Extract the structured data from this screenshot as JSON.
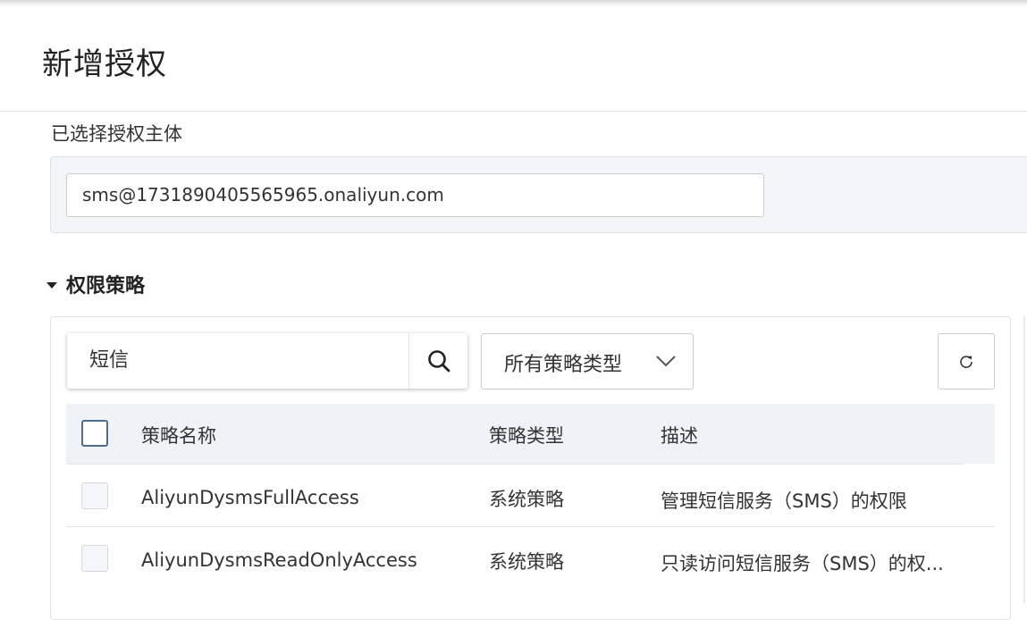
{
  "dialog": {
    "title": "新增授权",
    "selected_principal_label": "已选择授权主体",
    "principal_value": "sms@1731890405565965.onaliyun.com"
  },
  "policy_section": {
    "title": "权限策略",
    "search_value": "短信",
    "type_filter": "所有策略类型",
    "icons": {
      "search": "search-icon",
      "dropdown": "chevron-down-icon",
      "refresh": "refresh-icon",
      "collapse": "caret-down-icon"
    },
    "columns": [
      "策略名称",
      "策略类型",
      "描述"
    ],
    "rows": [
      {
        "name": "AliyunDysmsFullAccess",
        "type": "系统策略",
        "description": "管理短信服务（SMS）的权限"
      },
      {
        "name": "AliyunDysmsReadOnlyAccess",
        "type": "系统策略",
        "description": "只读访问短信服务（SMS）的权..."
      }
    ]
  },
  "colors": {
    "header_bg": "#eff3f8",
    "principal_bg": "#f3f6f9",
    "checkbox_border": "#4f6d8a"
  }
}
